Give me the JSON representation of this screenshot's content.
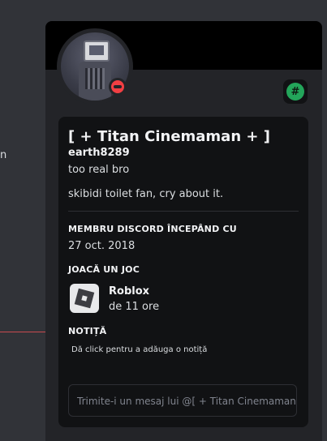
{
  "background": {
    "side_text": "n"
  },
  "profile": {
    "display_name": "[ + Titan Cinemaman + ]",
    "username": "earth8289",
    "pronouns": "too real bro",
    "bio": "skibidi toilet fan, cry about it.",
    "status": "do-not-disturb",
    "status_color": "#f23f43",
    "badge_icon": "hashtag-badge-icon",
    "badge_symbol": "#",
    "badge_color": "#23a55a"
  },
  "member_since": {
    "title": "MEMBRU DISCORD ÎNCEPÂND CU",
    "date": "27 oct. 2018"
  },
  "activity": {
    "title": "JOACĂ UN JOC",
    "game": "Roblox",
    "duration": "de 11 ore"
  },
  "note": {
    "title": "NOTIȚĂ",
    "placeholder": "Dă click pentru a adăuga o notiță"
  },
  "message": {
    "placeholder": "Trimite-i un mesaj lui @[ + Titan Cinemaman + ]"
  }
}
